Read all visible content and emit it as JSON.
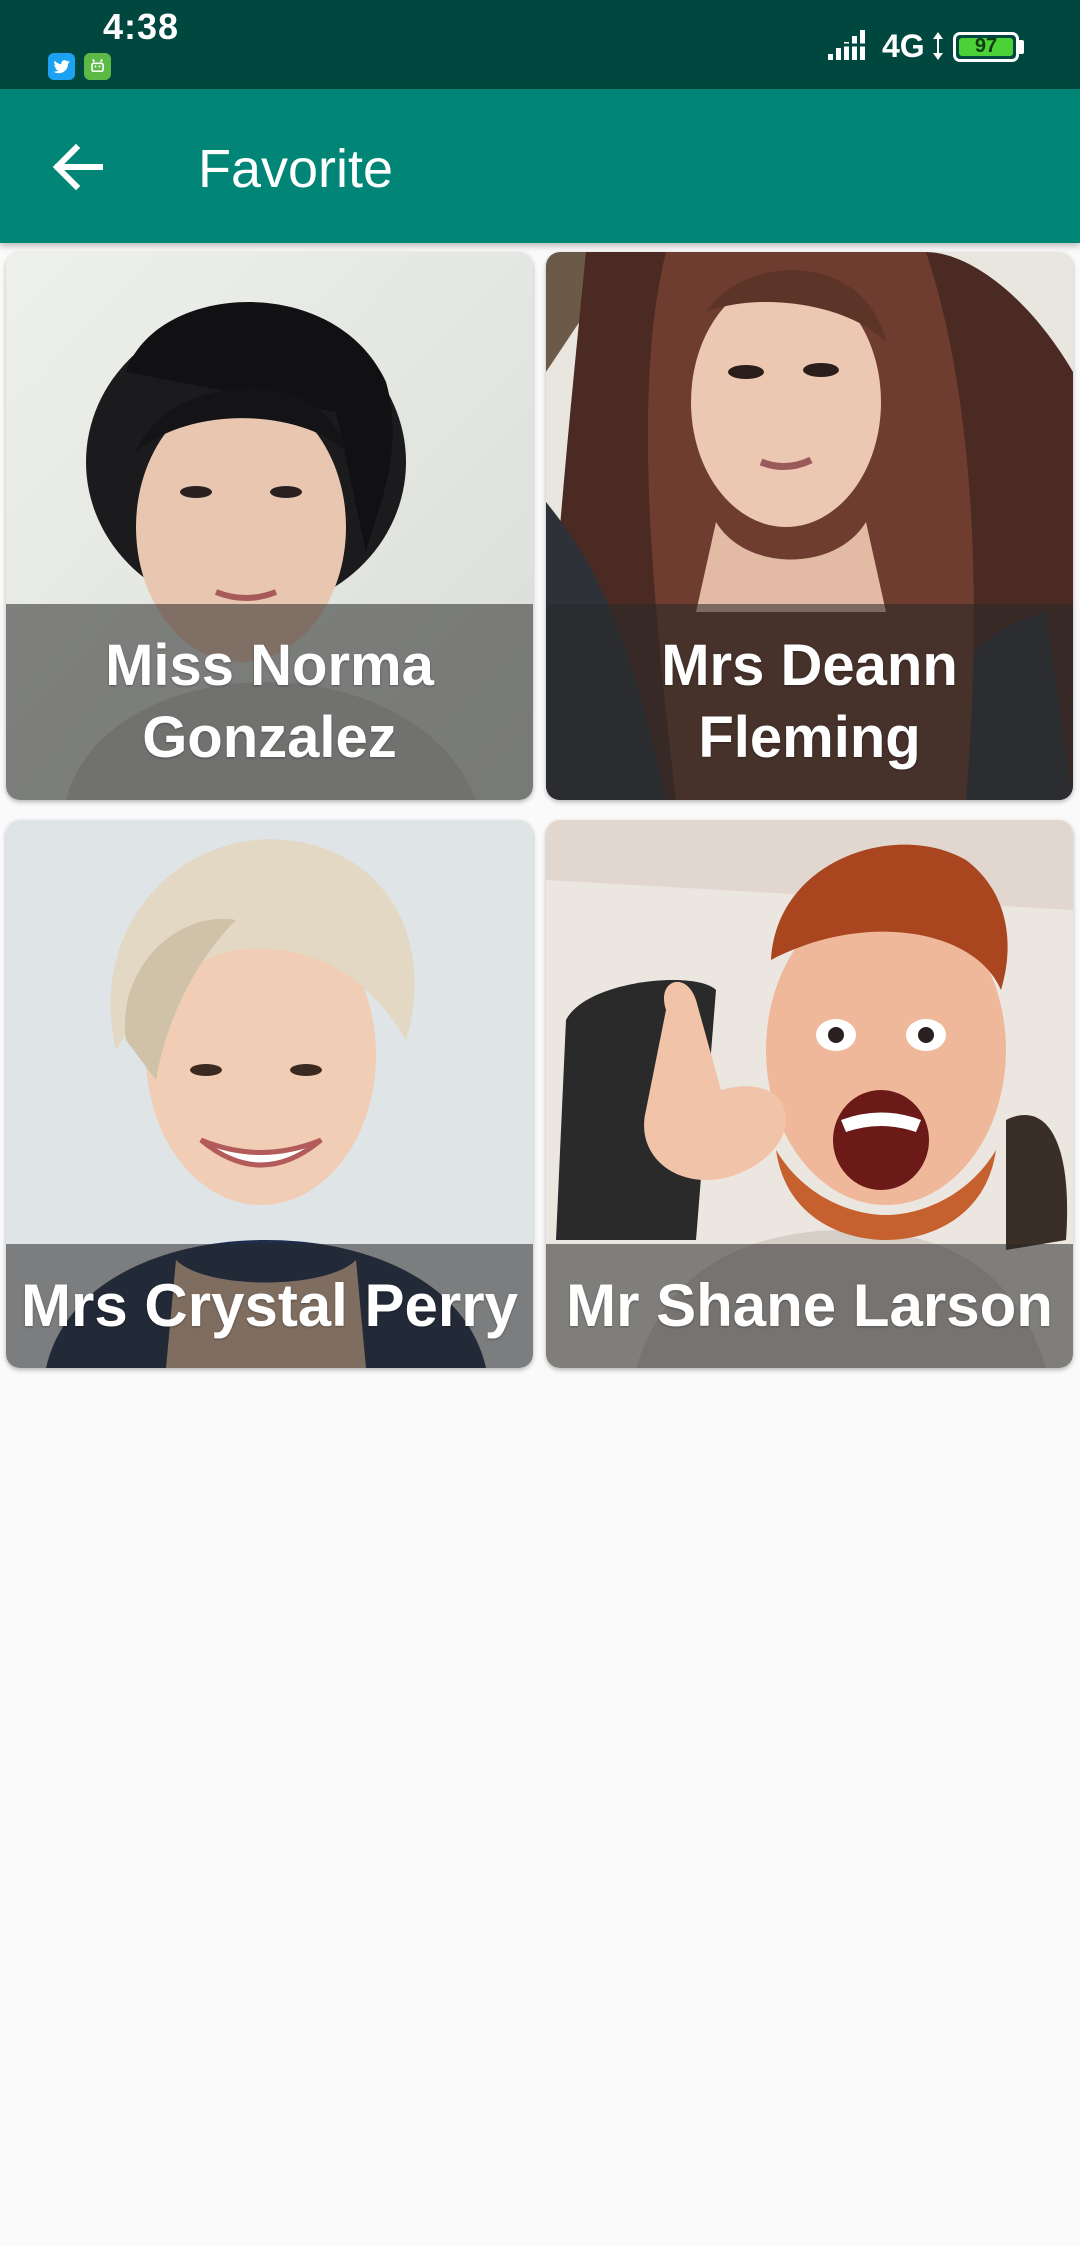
{
  "status_bar": {
    "time": "4:38",
    "network": "4G",
    "battery": "97",
    "notification_icons": [
      "twitter-icon",
      "android-icon"
    ],
    "battery_color": "#4cd137"
  },
  "app_bar": {
    "title": "Favorite",
    "back_icon": "arrow-left-icon",
    "background": "#008577"
  },
  "favorites": [
    {
      "name": "Miss Norma Gonzalez"
    },
    {
      "name": "Mrs Deann Fleming"
    },
    {
      "name": "Mrs Crystal Perry"
    },
    {
      "name": "Mr Shane Larson"
    }
  ]
}
